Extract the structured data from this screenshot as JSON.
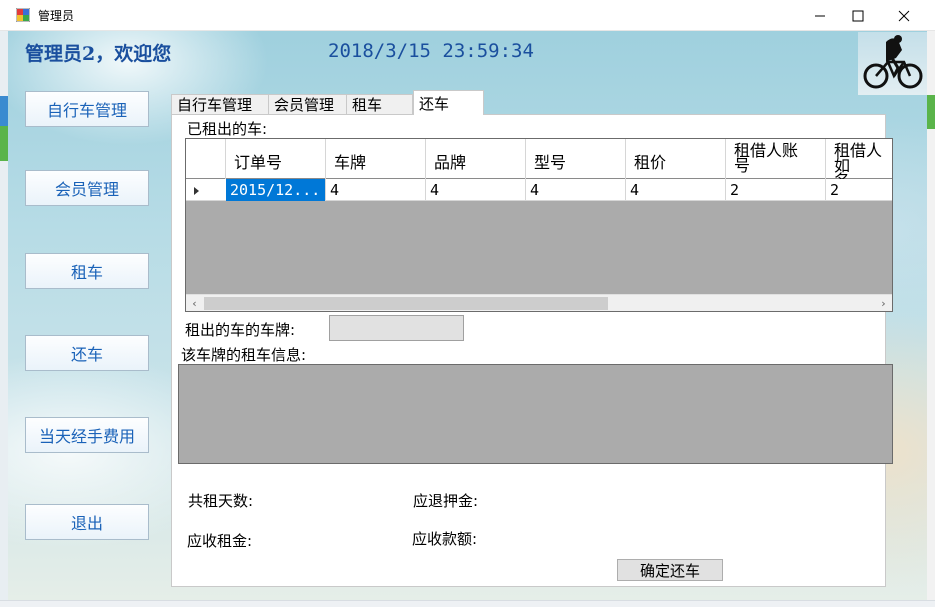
{
  "window": {
    "title": "管理员",
    "minimize_icon": "minimize-icon",
    "maximize_icon": "maximize-icon",
    "close_icon": "close-icon"
  },
  "header": {
    "welcome": "管理员2，欢迎您",
    "datetime": "2018/3/15  23:59:34",
    "logo_icon": "cyclist-logo"
  },
  "sidebar": {
    "items": [
      {
        "label": "自行车管理"
      },
      {
        "label": "会员管理"
      },
      {
        "label": "租车"
      },
      {
        "label": "还车"
      },
      {
        "label": "当天经手费用"
      },
      {
        "label": "退出"
      }
    ]
  },
  "tabs": [
    {
      "label": "自行车管理"
    },
    {
      "label": "会员管理"
    },
    {
      "label": "租车"
    },
    {
      "label": "还车",
      "active": true
    }
  ],
  "return_panel": {
    "rented_label": "已租出的车:",
    "grid": {
      "columns": [
        "订单号",
        "车牌",
        "品牌",
        "型号",
        "租价",
        "租借人账号",
        "租借人姓名"
      ],
      "header_display": [
        "订单号",
        "车牌",
        "品牌",
        "型号",
        "租价",
        "租借人账\n号",
        "租借人如\n名"
      ],
      "rows": [
        [
          "2015/12...",
          "4",
          "4",
          "4",
          "4",
          "2",
          "2"
        ]
      ]
    },
    "plate_label": "租出的车的车牌:",
    "plate_value": "",
    "info_label": "该车牌的租车信息:",
    "days_label": "共租天数:",
    "deposit_refund_label": "应退押金:",
    "rent_due_label": "应收租金:",
    "amount_due_label": "应收款额:",
    "confirm_button": "确定还车"
  },
  "colors": {
    "accent_text": "#1a4f9e",
    "button_text": "#1a62b8",
    "selection": "#0078d7"
  }
}
